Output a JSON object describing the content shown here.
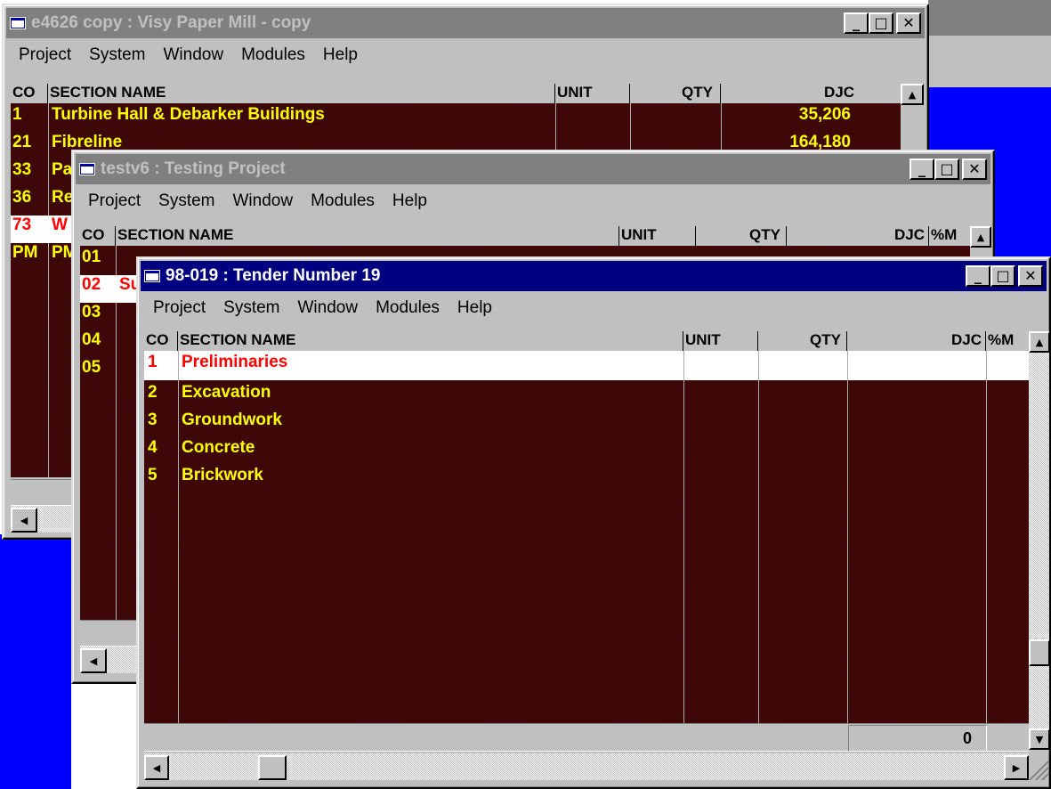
{
  "window1": {
    "title": "e4626 copy : Visy Paper Mill - copy",
    "menu": [
      "Project",
      "System",
      "Window",
      "Modules",
      "Help"
    ],
    "columns": {
      "co": "CO",
      "name": "SECTION NAME",
      "unit": "UNIT",
      "qty": "QTY",
      "djc": "DJC"
    },
    "rows": [
      {
        "co": "1",
        "name": "Turbine Hall & Debarker Buildings",
        "djc": "35,206"
      },
      {
        "co": "21",
        "name": "Fibreline",
        "djc": "164,180"
      },
      {
        "co": "33",
        "name": "Pa"
      },
      {
        "co": "36",
        "name": "Re"
      },
      {
        "co": "73",
        "name": "W"
      },
      {
        "co": "PM",
        "name": "PM"
      }
    ]
  },
  "window2": {
    "title": "testv6 : Testing Project",
    "menu": [
      "Project",
      "System",
      "Window",
      "Modules",
      "Help"
    ],
    "columns": {
      "co": "CO",
      "name": "SECTION NAME",
      "unit": "UNIT",
      "qty": "QTY",
      "djc": "DJC",
      "pm": "%M"
    },
    "rows": [
      {
        "co": "01",
        "name": ""
      },
      {
        "co": "02",
        "name": "Su"
      },
      {
        "co": "03",
        "name": ""
      },
      {
        "co": "04",
        "name": ""
      },
      {
        "co": "05",
        "name": ""
      }
    ]
  },
  "window3": {
    "title": "98-019 : Tender Number 19",
    "menu": [
      "Project",
      "System",
      "Window",
      "Modules",
      "Help"
    ],
    "columns": {
      "co": "CO",
      "name": "SECTION NAME",
      "unit": "UNIT",
      "qty": "QTY",
      "djc": "DJC",
      "pm": "%M"
    },
    "rows": [
      {
        "co": "1",
        "name": "Preliminaries"
      },
      {
        "co": "2",
        "name": "Excavation"
      },
      {
        "co": "3",
        "name": "Groundwork"
      },
      {
        "co": "4",
        "name": "Concrete"
      },
      {
        "co": "5",
        "name": "Brickwork"
      }
    ],
    "total": "0"
  },
  "title_buttons": {
    "minimize": "_",
    "maximize": "□",
    "close": "✕"
  },
  "scroll_glyphs": {
    "up": "▲",
    "down": "▼",
    "left": "◀",
    "right": "▶"
  }
}
